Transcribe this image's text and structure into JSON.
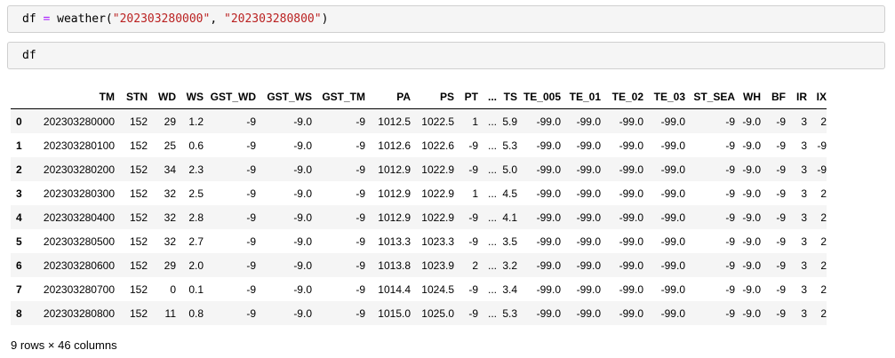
{
  "cells": [
    {
      "tokens": [
        {
          "t": "df ",
          "k": "var"
        },
        {
          "t": "=",
          "k": "op"
        },
        {
          "t": " weather(",
          "k": "var"
        },
        {
          "t": "\"202303280000\"",
          "k": "str"
        },
        {
          "t": ", ",
          "k": "var"
        },
        {
          "t": "\"202303280800\"",
          "k": "str"
        },
        {
          "t": ")",
          "k": "var"
        }
      ]
    },
    {
      "tokens": [
        {
          "t": "df",
          "k": "var"
        }
      ]
    }
  ],
  "table": {
    "columns": [
      "",
      "TM",
      "STN",
      "WD",
      "WS",
      "GST_WD",
      "GST_WS",
      "GST_TM",
      "PA",
      "PS",
      "PT",
      "...",
      "TS",
      "TE_005",
      "TE_01",
      "TE_02",
      "TE_03",
      "ST_SEA",
      "WH",
      "BF",
      "IR",
      "IX"
    ],
    "rows": [
      {
        "index": "0",
        "cells": [
          "202303280000",
          "152",
          "29",
          "1.2",
          "-9",
          "-9.0",
          "-9",
          "1012.5",
          "1022.5",
          "1",
          "...",
          "5.9",
          "-99.0",
          "-99.0",
          "-99.0",
          "-99.0",
          "-9",
          "-9.0",
          "-9",
          "3",
          "2"
        ]
      },
      {
        "index": "1",
        "cells": [
          "202303280100",
          "152",
          "25",
          "0.6",
          "-9",
          "-9.0",
          "-9",
          "1012.6",
          "1022.6",
          "-9",
          "...",
          "5.3",
          "-99.0",
          "-99.0",
          "-99.0",
          "-99.0",
          "-9",
          "-9.0",
          "-9",
          "3",
          "-9"
        ]
      },
      {
        "index": "2",
        "cells": [
          "202303280200",
          "152",
          "34",
          "2.3",
          "-9",
          "-9.0",
          "-9",
          "1012.9",
          "1022.9",
          "-9",
          "...",
          "5.0",
          "-99.0",
          "-99.0",
          "-99.0",
          "-99.0",
          "-9",
          "-9.0",
          "-9",
          "3",
          "-9"
        ]
      },
      {
        "index": "3",
        "cells": [
          "202303280300",
          "152",
          "32",
          "2.5",
          "-9",
          "-9.0",
          "-9",
          "1012.9",
          "1022.9",
          "1",
          "...",
          "4.5",
          "-99.0",
          "-99.0",
          "-99.0",
          "-99.0",
          "-9",
          "-9.0",
          "-9",
          "3",
          "2"
        ]
      },
      {
        "index": "4",
        "cells": [
          "202303280400",
          "152",
          "32",
          "2.8",
          "-9",
          "-9.0",
          "-9",
          "1012.9",
          "1022.9",
          "-9",
          "...",
          "4.1",
          "-99.0",
          "-99.0",
          "-99.0",
          "-99.0",
          "-9",
          "-9.0",
          "-9",
          "3",
          "2"
        ]
      },
      {
        "index": "5",
        "cells": [
          "202303280500",
          "152",
          "32",
          "2.7",
          "-9",
          "-9.0",
          "-9",
          "1013.3",
          "1023.3",
          "-9",
          "...",
          "3.5",
          "-99.0",
          "-99.0",
          "-99.0",
          "-99.0",
          "-9",
          "-9.0",
          "-9",
          "3",
          "2"
        ]
      },
      {
        "index": "6",
        "cells": [
          "202303280600",
          "152",
          "29",
          "2.0",
          "-9",
          "-9.0",
          "-9",
          "1013.8",
          "1023.9",
          "2",
          "...",
          "3.2",
          "-99.0",
          "-99.0",
          "-99.0",
          "-99.0",
          "-9",
          "-9.0",
          "-9",
          "3",
          "2"
        ]
      },
      {
        "index": "7",
        "cells": [
          "202303280700",
          "152",
          "0",
          "0.1",
          "-9",
          "-9.0",
          "-9",
          "1014.4",
          "1024.5",
          "-9",
          "...",
          "3.4",
          "-99.0",
          "-99.0",
          "-99.0",
          "-99.0",
          "-9",
          "-9.0",
          "-9",
          "3",
          "2"
        ]
      },
      {
        "index": "8",
        "cells": [
          "202303280800",
          "152",
          "11",
          "0.8",
          "-9",
          "-9.0",
          "-9",
          "1015.0",
          "1025.0",
          "-9",
          "...",
          "5.3",
          "-99.0",
          "-99.0",
          "-99.0",
          "-99.0",
          "-9",
          "-9.0",
          "-9",
          "3",
          "2"
        ]
      }
    ]
  },
  "summary": "9 rows × 46 columns",
  "colors": {
    "cell_background": "#f5f5f5",
    "cell_border": "#cfcfcf",
    "operator": "#aa22ff",
    "string": "#ba2121",
    "stripe": "#f5f5f5"
  }
}
